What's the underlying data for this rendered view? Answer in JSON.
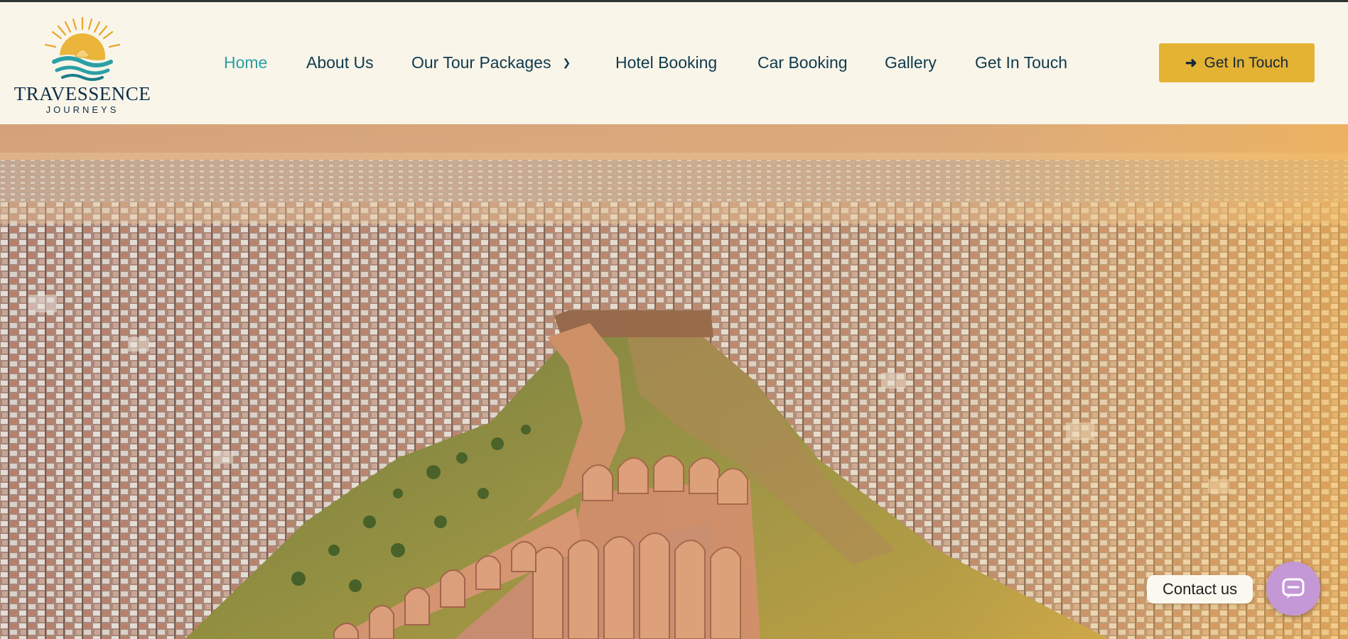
{
  "brand": {
    "name": "TRAVESSENCE",
    "tagline": "JOURNEYS",
    "logo_icon": "sun-over-waves-logo",
    "colors": {
      "navy": "#0f2f48",
      "teal": "#2b9ea3",
      "gold": "#e4b334"
    }
  },
  "nav": {
    "items": [
      {
        "label": "Home",
        "active": true
      },
      {
        "label": "About Us"
      },
      {
        "label": "Our Tour Packages",
        "icon": "chevron-down-icon"
      },
      {
        "label": "Hotel Booking"
      },
      {
        "label": "Car Booking"
      },
      {
        "label": "Gallery"
      },
      {
        "label": "Get In Touch"
      }
    ]
  },
  "cta": {
    "label": "Get In Touch",
    "icon": "arrow-right-icon"
  },
  "hero": {
    "image": "aerial-view-of-hilltop-fort-wall-over-city-at-sunset"
  },
  "chat_widget": {
    "label": "Contact us",
    "icon": "chat-bubble-icon"
  }
}
